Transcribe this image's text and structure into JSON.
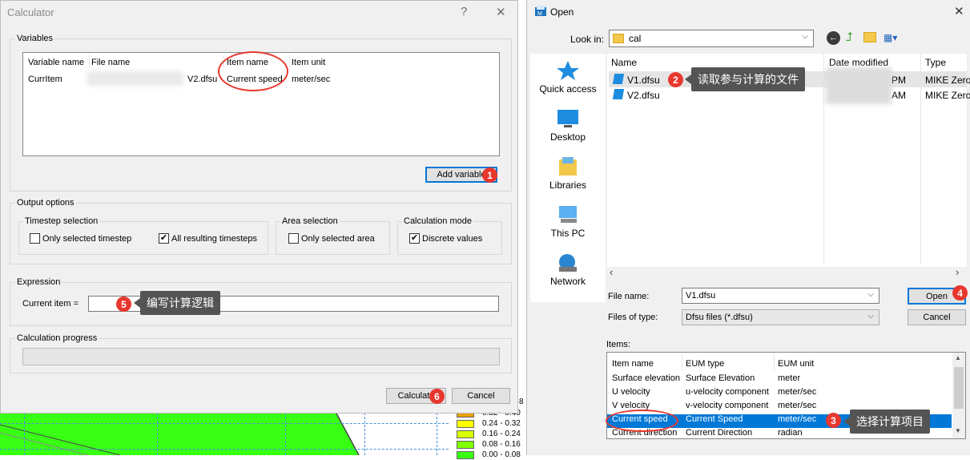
{
  "calculator": {
    "title": "Calculator",
    "help_glyph": "?",
    "close_glyph": "✕",
    "variables_group": "Variables",
    "var_columns": [
      "Variable name",
      "File name",
      "Item name",
      "Item unit"
    ],
    "var_row": {
      "variable_name": "CurrItem",
      "file_name": "V2.dfsu",
      "item_name": "Current speed",
      "item_unit": "meter/sec"
    },
    "add_variable_label": "Add variable",
    "output_options_group": "Output options",
    "timestep_group": "Timestep selection",
    "only_selected_timestep": "Only selected timestep",
    "all_resulting_timesteps": "All resulting timesteps",
    "area_group": "Area selection",
    "only_selected_area": "Only selected area",
    "calc_mode_group": "Calculation mode",
    "discrete_values": "Discrete values",
    "expression_group": "Expression",
    "current_item_label": "Current item =",
    "current_item_value": "",
    "progress_group": "Calculation progress",
    "calculate_label": "Calculate",
    "cancel_label": "Cancel"
  },
  "annotations": {
    "badge1": "1",
    "badge2": "2",
    "badge3": "3",
    "badge4": "4",
    "badge5": "5",
    "badge6": "6",
    "callout2": "读取参与计算的文件",
    "callout3": "选择计算项目",
    "callout5": "编写计算逻辑"
  },
  "legend": {
    "values": [
      "8",
      "0.32 - 0.40",
      "0.24 - 0.32",
      "0.16 - 0.24",
      "0.08 - 0.16",
      "0.00 - 0.08"
    ],
    "colors": [
      "#cc8a00",
      "#e8a200",
      "#ffff00",
      "#d8ff00",
      "#80ff00",
      "#39ff14"
    ]
  },
  "open_dialog": {
    "title": "Open",
    "close_glyph": "✕",
    "look_in_label": "Look in:",
    "look_in_value": "cal",
    "sidebar": [
      {
        "label": "Quick access",
        "icon": "star-icon"
      },
      {
        "label": "Desktop",
        "icon": "desktop-icon"
      },
      {
        "label": "Libraries",
        "icon": "libraries-icon"
      },
      {
        "label": "This PC",
        "icon": "computer-icon"
      },
      {
        "label": "Network",
        "icon": "network-icon"
      }
    ],
    "file_columns": [
      "Name",
      "Date modified",
      "Type"
    ],
    "files": [
      {
        "name": "V1.dfsu",
        "date": "PM",
        "type": "MIKE Zero"
      },
      {
        "name": "V2.dfsu",
        "date": "AM",
        "type": "MIKE Zero"
      }
    ],
    "file_name_label": "File name:",
    "file_name_value": "V1.dfsu",
    "files_of_type_label": "Files of type:",
    "files_of_type_value": "Dfsu files (*.dfsu)",
    "open_label": "Open",
    "cancel_label": "Cancel",
    "items_label": "Items:",
    "items_columns": [
      "Item name",
      "EUM type",
      "EUM unit"
    ],
    "items": [
      {
        "name": "Surface elevation",
        "eum_type": "Surface Elevation",
        "unit": "meter"
      },
      {
        "name": "U velocity",
        "eum_type": "u-velocity component",
        "unit": "meter/sec"
      },
      {
        "name": "V velocity",
        "eum_type": "v-velocity component",
        "unit": "meter/sec"
      },
      {
        "name": "Current speed",
        "eum_type": "Current Speed",
        "unit": "meter/sec"
      },
      {
        "name": "Current direction",
        "eum_type": "Current Direction",
        "unit": "radian"
      }
    ],
    "selected_item_index": 3,
    "scroll_left": "‹",
    "scroll_right": "›",
    "scroll_up": "▲",
    "scroll_down": "▼"
  }
}
